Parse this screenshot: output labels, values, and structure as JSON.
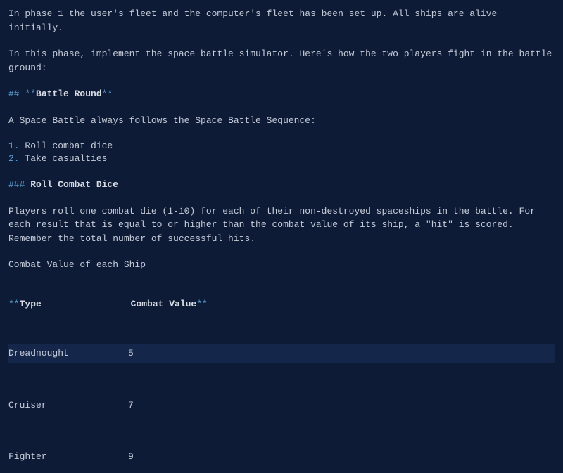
{
  "intro": {
    "p1": "In phase 1 the user's fleet and the computer's fleet has been set up. All ships are alive initially.",
    "p2": "In this phase, implement the space battle simulator. Here's how the two players fight in the battle ground:"
  },
  "heading1": {
    "marker_open": "## **",
    "text": "Battle Round",
    "marker_close": "**"
  },
  "sequence_intro": "A Space Battle always follows the Space Battle Sequence:",
  "steps": [
    {
      "num": "1.",
      "text": " Roll combat dice"
    },
    {
      "num": "2.",
      "text": " Take casualties"
    }
  ],
  "heading2": {
    "marker": "### ",
    "text": "Roll Combat Dice"
  },
  "roll_desc": "Players roll one combat die (1-10) for each of their non-destroyed  spaceships in the battle. For each result that is equal to or higher  than the combat value of its ship, a \"hit\" is scored. Remember the total  number of successful hits.",
  "cv_label": "Combat Value of each Ship",
  "table": {
    "header": {
      "marker_open": "**",
      "c1": "Type",
      "c2": "Combat Value",
      "marker_close": "**"
    },
    "rows": [
      {
        "type": "Dreadnought",
        "value": "5"
      },
      {
        "type": "Cruiser",
        "value": "7"
      },
      {
        "type": "Fighter",
        "value": "9"
      }
    ]
  }
}
